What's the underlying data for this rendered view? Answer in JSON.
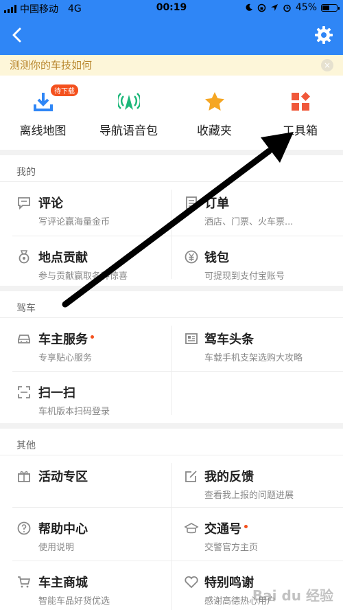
{
  "status": {
    "carrier": "中国移动",
    "network": "4G",
    "time": "00:19",
    "battery": "45%",
    "battery_level": 0.45
  },
  "nav": {
    "back_icon": "chevron-left-icon",
    "settings_icon": "gear-icon",
    "accent": "#2f86f6"
  },
  "tip": {
    "text": "测测你的车技如何",
    "close": "×"
  },
  "quick": [
    {
      "label": "离线地图",
      "icon": "download-icon",
      "badge": "待下载",
      "color": "#2f86f6"
    },
    {
      "label": "导航语音包",
      "icon": "voice-signal-icon",
      "color": "#1db77a"
    },
    {
      "label": "收藏夹",
      "icon": "star-icon",
      "color": "#f5a623"
    },
    {
      "label": "工具箱",
      "icon": "toolbox-grid-icon",
      "color": "#f0583a"
    }
  ],
  "sections": {
    "mine": {
      "title": "我的",
      "items": [
        {
          "title": "评论",
          "sub": "写评论赢海量金币",
          "icon": "comment-icon"
        },
        {
          "title": "订单",
          "sub": "酒店、门票、火车票...",
          "icon": "order-icon"
        },
        {
          "title": "地点贡献",
          "sub": "参与贡献赢取各种惊喜",
          "icon": "medal-icon"
        },
        {
          "title": "钱包",
          "sub": "可提现到支付宝账号",
          "icon": "wallet-icon"
        }
      ]
    },
    "driving": {
      "title": "驾车",
      "items": [
        {
          "title": "车主服务",
          "sub": "专享贴心服务",
          "icon": "car-icon",
          "dot": true
        },
        {
          "title": "驾车头条",
          "sub": "车载手机支架选购大攻略",
          "icon": "news-icon"
        },
        {
          "title": "扫一扫",
          "sub": "车机版本扫码登录",
          "icon": "scan-icon"
        }
      ]
    },
    "other": {
      "title": "其他",
      "items": [
        {
          "title": "活动专区",
          "sub": "",
          "icon": "gift-icon"
        },
        {
          "title": "我的反馈",
          "sub": "查看我上报的问题进展",
          "icon": "edit-icon"
        },
        {
          "title": "帮助中心",
          "sub": "使用说明",
          "icon": "help-icon"
        },
        {
          "title": "交通号",
          "sub": "交警官方主页",
          "icon": "police-icon",
          "dot": true
        },
        {
          "title": "车主商城",
          "sub": "智能车品好货优选",
          "icon": "cart-icon"
        },
        {
          "title": "特别鸣谢",
          "sub": "感谢高德热心用户",
          "icon": "heart-icon"
        }
      ]
    }
  },
  "watermark": "Bai du 经验"
}
